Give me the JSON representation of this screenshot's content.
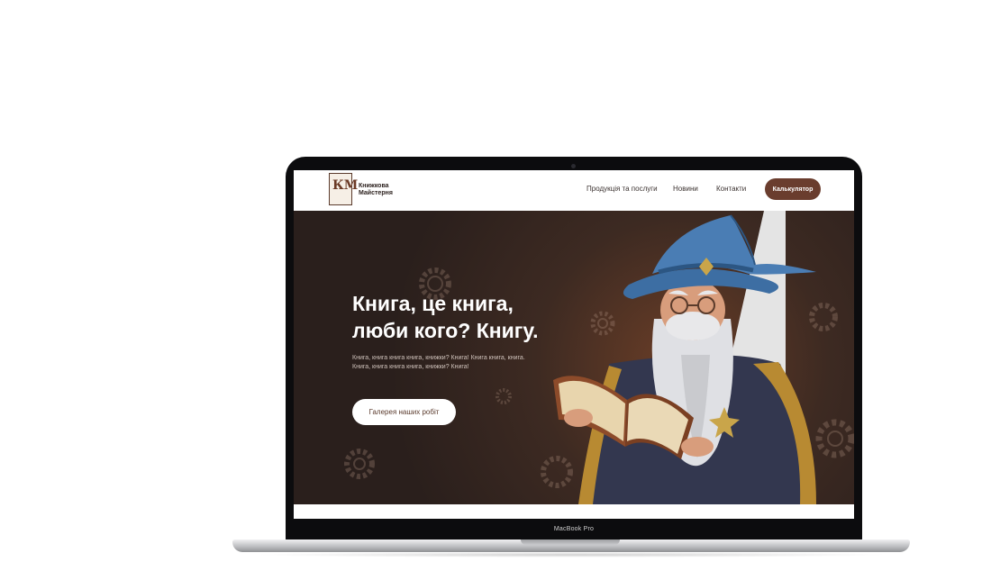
{
  "device": {
    "label": "MacBook Pro"
  },
  "site": {
    "logo": {
      "monogram": "КМ",
      "line1": "Книжкова",
      "line2": "Майстерня"
    },
    "nav": {
      "items": [
        "Продукція та послуги",
        "Новини",
        "Контакти"
      ],
      "cta": "Калькулятор"
    },
    "hero": {
      "title_line1": "Книга, це книга,",
      "title_line2": "люби кого? Книгу.",
      "subtitle_line1": "Книга, книга книга книга, книжки? Книга! Книга книга, книга.",
      "subtitle_line2": "Книга, книга книга книга, книжки? Книга!",
      "button": "Галерея наших робіт"
    }
  },
  "colors": {
    "accent_brown": "#6a3d2e",
    "hero_dark": "#2a1f1c",
    "hat_blue": "#3d6ea3"
  }
}
